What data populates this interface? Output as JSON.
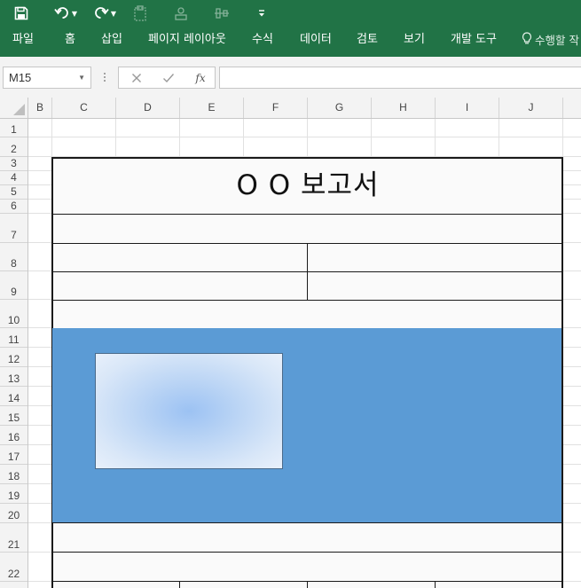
{
  "ribbon": {
    "background_color": "#217346",
    "quick_access": [
      {
        "name": "save-icon",
        "enabled": true
      },
      {
        "name": "undo-icon",
        "enabled": true,
        "has_dropdown": true
      },
      {
        "name": "redo-icon",
        "enabled": true,
        "has_dropdown": true
      },
      {
        "name": "paste-format-icon",
        "enabled": false
      },
      {
        "name": "shapes-icon",
        "enabled": false
      },
      {
        "name": "align-icon",
        "enabled": false
      },
      {
        "name": "customize-qat-icon",
        "enabled": true
      }
    ],
    "tabs": [
      "파일",
      "홈",
      "삽입",
      "페이지 레이아웃",
      "수식",
      "데이터",
      "검토",
      "보기",
      "개발 도구"
    ],
    "tell_me": {
      "icon": "lightbulb-icon",
      "label": "수행할 작"
    }
  },
  "formula_bar": {
    "name_box": "M15",
    "cancel_icon": "close-icon",
    "enter_icon": "check-icon",
    "function_label": "fx",
    "formula_value": ""
  },
  "columns": [
    "B",
    "C",
    "D",
    "E",
    "F",
    "G",
    "H",
    "I",
    "J"
  ],
  "rows": [
    "1",
    "2",
    "3",
    "4",
    "5",
    "6",
    "7",
    "8",
    "9",
    "10",
    "11",
    "12",
    "13",
    "14",
    "15",
    "16",
    "17",
    "18",
    "19",
    "20",
    "21",
    "22"
  ],
  "report": {
    "title": "O O 보고서",
    "panel_color": "#5b9bd5",
    "picture_gradient": [
      "#9cc2f3",
      "#e8f0fb"
    ]
  }
}
